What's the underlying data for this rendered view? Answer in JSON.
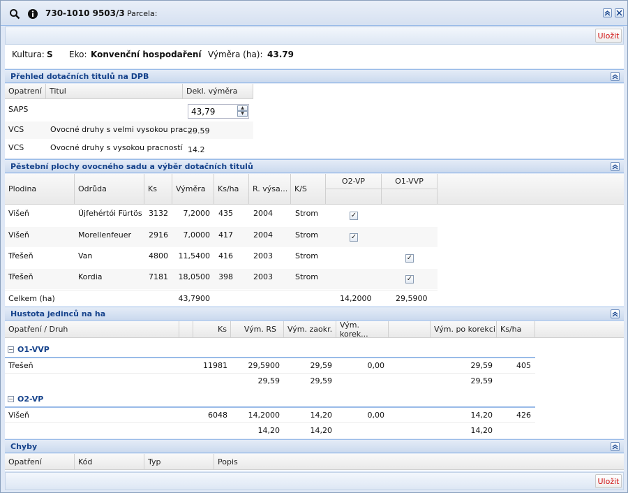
{
  "titlebar": {
    "parcel_code": "730-1010 9503/3",
    "parcela_label": "Parcela:",
    "icons": [
      "search-icon",
      "info-icon",
      "collapse-icon",
      "close-icon"
    ]
  },
  "toolbar": {
    "save_label": "Uložit"
  },
  "info": {
    "kultura_label": "Kultura:",
    "kultura_value": "S",
    "eko_label": "Eko:",
    "eko_value": "Konvenční hospodaření",
    "vymera_label": "Výměra (ha):",
    "vymera_value": "43.79"
  },
  "section1": {
    "title": "Přehled dotačních titulů na DPB",
    "columns": [
      "Opatrení",
      "Titul",
      "Dekl. výměra"
    ],
    "rows": [
      {
        "opatreni": "SAPS",
        "titul": "",
        "vymera": "43,79"
      },
      {
        "opatreni": "VCS",
        "titul": "Ovocné druhy s velmi vysokou prac...",
        "vymera": "29.59"
      },
      {
        "opatreni": "VCS",
        "titul": "Ovocné druhy s vysokou pracností",
        "vymera": "14.2"
      }
    ]
  },
  "section2": {
    "title": "Pěstební plochy ovocného sadu a výběr dotačních titulů",
    "columns": [
      "Plodina",
      "Odrůda",
      "Ks",
      "Výměra",
      "Ks/ha",
      "R. výsa...",
      "K/S",
      "O2-VP",
      "O1-VVP"
    ],
    "rows": [
      {
        "plodina": "Višeň",
        "odruda": "Újfehértói Fürtös",
        "ks": "3132",
        "vymera": "7,2000",
        "ksha": "435",
        "rok": "2004",
        "ks_type": "Strom",
        "o2": true,
        "o1": false
      },
      {
        "plodina": "Višeň",
        "odruda": "Morellenfeuer",
        "ks": "2916",
        "vymera": "7,0000",
        "ksha": "417",
        "rok": "2004",
        "ks_type": "Strom",
        "o2": true,
        "o1": false
      },
      {
        "plodina": "Třešeň",
        "odruda": "Van",
        "ks": "4800",
        "vymera": "11,5400",
        "ksha": "416",
        "rok": "2003",
        "ks_type": "Strom",
        "o2": false,
        "o1": true
      },
      {
        "plodina": "Třešeň",
        "odruda": "Kordia",
        "ks": "7181",
        "vymera": "18,0500",
        "ksha": "398",
        "rok": "2003",
        "ks_type": "Strom",
        "o2": false,
        "o1": true
      }
    ],
    "total": {
      "label": "Celkem (ha)",
      "vymera": "43,7900",
      "o2": "14,2000",
      "o1": "29,5900"
    }
  },
  "section3": {
    "title": "Hustota jedinců na ha",
    "columns": [
      "Opatření / Druh",
      "Ks",
      "Vým. RS",
      "Vým. zaokr.",
      "Vým. korek...",
      "Vým. po korekci",
      "Ks/ha"
    ],
    "groups": [
      {
        "name": "O1-VVP",
        "row": {
          "druh": "Třešeň",
          "ks": "11981",
          "rs": "29,5900",
          "zaokr": "29,59",
          "korek": "0,00",
          "po": "29,59",
          "ksha": "405"
        },
        "sum": {
          "rs": "29,59",
          "zaokr": "29,59",
          "po": "29,59"
        }
      },
      {
        "name": "O2-VP",
        "row": {
          "druh": "Višeň",
          "ks": "6048",
          "rs": "14,2000",
          "zaokr": "14,20",
          "korek": "0,00",
          "po": "14,20",
          "ksha": "426"
        },
        "sum": {
          "rs": "14,20",
          "zaokr": "14,20",
          "po": "14,20"
        }
      }
    ]
  },
  "section4": {
    "title": "Chyby",
    "columns": [
      "Opatření",
      "Kód",
      "Typ",
      "Popis"
    ]
  },
  "footer": {
    "save_label": "Uložit"
  }
}
